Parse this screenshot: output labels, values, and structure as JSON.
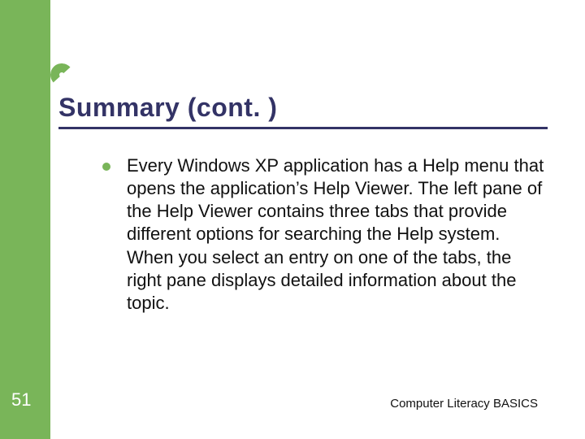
{
  "slide": {
    "title": "Summary (cont. )",
    "page_number": "51",
    "footer": "Computer Literacy BASICS",
    "bullets": [
      {
        "text": "Every Windows XP application has a Help menu that opens the application’s Help Viewer. The left pane of the Help Viewer contains three tabs that provide different options for searching the Help system. When you select an entry on one of the tabs, the right pane displays detailed information about the topic."
      }
    ]
  },
  "colors": {
    "accent_green": "#79b559",
    "title_navy": "#333366"
  }
}
